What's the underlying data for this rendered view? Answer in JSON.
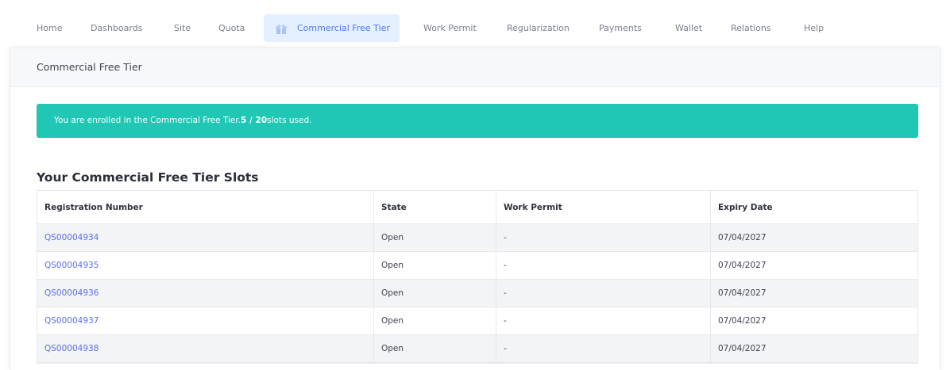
{
  "nav": {
    "items": [
      {
        "label": "Home"
      },
      {
        "label": "Dashboards"
      },
      {
        "label": "Site"
      },
      {
        "label": "Quota"
      },
      {
        "label": "Commercial Free Tier",
        "icon": "gift-icon",
        "active": true
      },
      {
        "label": "Work Permit"
      },
      {
        "label": "Regularization"
      },
      {
        "label": "Payments"
      },
      {
        "label": "Wallet"
      },
      {
        "label": "Relations"
      },
      {
        "label": "Help"
      }
    ]
  },
  "card": {
    "title": "Commercial Free Tier"
  },
  "banner": {
    "prefix": "You are enrolled in the Commercial Free Tier.",
    "slots_used": "5 / 20",
    "suffix": "slots used.",
    "color": "#1fc7b4"
  },
  "slots": {
    "title": "Your Commercial Free Tier Slots",
    "columns": [
      "Registration Number",
      "State",
      "Work Permit",
      "Expiry Date"
    ],
    "rows": [
      {
        "registration": "QS00004934",
        "state": "Open",
        "work_permit": "-",
        "expiry": "07/04/2027"
      },
      {
        "registration": "QS00004935",
        "state": "Open",
        "work_permit": "-",
        "expiry": "07/04/2027"
      },
      {
        "registration": "QS00004936",
        "state": "Open",
        "work_permit": "-",
        "expiry": "07/04/2027"
      },
      {
        "registration": "QS00004937",
        "state": "Open",
        "work_permit": "-",
        "expiry": "07/04/2027"
      },
      {
        "registration": "QS00004938",
        "state": "Open",
        "work_permit": "-",
        "expiry": "07/04/2027"
      }
    ]
  },
  "colors": {
    "accent": "#4a7df0",
    "active_tab_bg": "#e4efff",
    "link": "#5a6ee8"
  }
}
